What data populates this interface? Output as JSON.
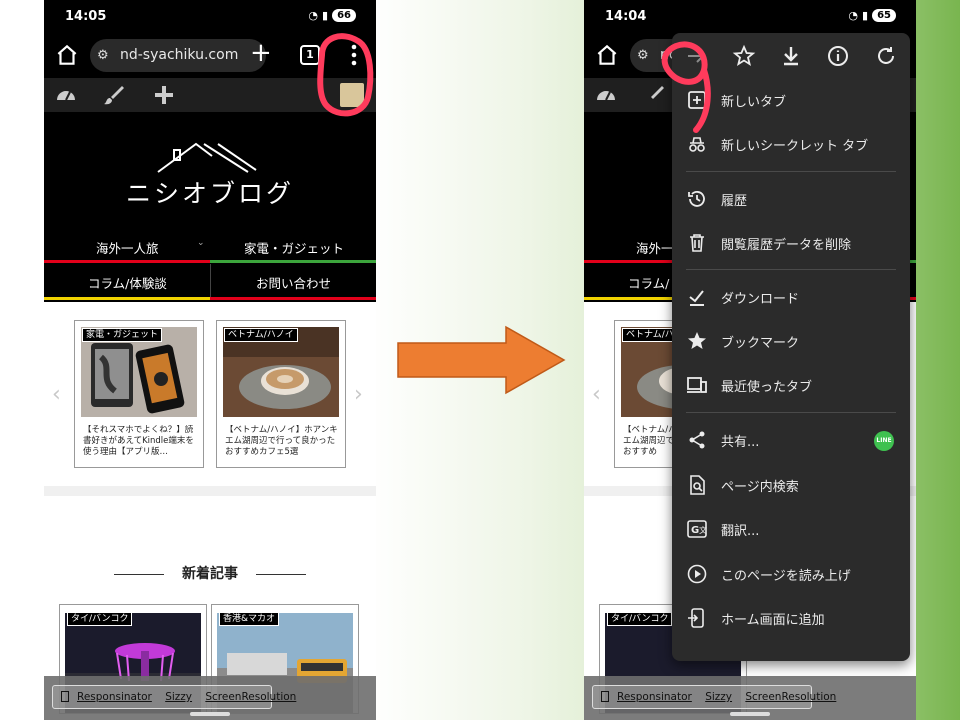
{
  "statusbar_left": {
    "time": "14:05",
    "battery": "66"
  },
  "statusbar_right": {
    "time": "14:04",
    "battery": "65"
  },
  "browser": {
    "url": "nd-syachiku.com",
    "url_partial": "nc",
    "tab_count": "1"
  },
  "site": {
    "logo": "ニシオブログ",
    "nav": [
      "海外一人旅",
      "家電・ガジェット",
      "コラム/体験談",
      "お問い合わせ"
    ],
    "nav_right_partial": [
      "海外一",
      "コラム/"
    ]
  },
  "carousel": [
    {
      "tag": "家電・ガジェット",
      "title": "【それスマホでよくね？】読書好きがあえてKindle端末を使う理由【アプリ版…"
    },
    {
      "tag": "ベトナム/ハノイ",
      "title": "【ベトナム/ハノイ】ホアンキエム湖周辺で行って良かったおすすめカフェ5選"
    }
  ],
  "carousel_right": {
    "tag": "ベトナム/ハ",
    "title": "【ベトナム/ハノイ】ホアンキエム湖周辺で行って良かったおすすめ"
  },
  "section": {
    "new_articles": "新着記事"
  },
  "new_cards": [
    {
      "tag": "タイ/バンコク"
    },
    {
      "tag": "香港&マカオ"
    }
  ],
  "devtools": {
    "links": [
      "Responsinator",
      "Sizzy",
      "ScreenResolution"
    ]
  },
  "menu": {
    "toolbar": [
      "forward-icon",
      "star-icon",
      "download-icon",
      "info-icon",
      "refresh-icon"
    ],
    "items": [
      {
        "label": "新しいタブ",
        "icon": "new-tab-icon"
      },
      {
        "label": "新しいシークレット タブ",
        "icon": "incognito-icon"
      },
      {
        "label": "履歴",
        "icon": "history-icon"
      },
      {
        "label": "閲覧履歴データを削除",
        "icon": "trash-icon"
      },
      {
        "label": "ダウンロード",
        "icon": "downloads-icon"
      },
      {
        "label": "ブックマーク",
        "icon": "bookmark-star-icon"
      },
      {
        "label": "最近使ったタブ",
        "icon": "recent-tabs-icon"
      },
      {
        "label": "共有...",
        "icon": "share-icon"
      },
      {
        "label": "ページ内検索",
        "icon": "find-in-page-icon"
      },
      {
        "label": "翻訳...",
        "icon": "translate-icon"
      },
      {
        "label": "このページを読み上げ",
        "icon": "read-aloud-icon"
      },
      {
        "label": "ホーム画面に追加",
        "icon": "add-to-home-icon"
      }
    ],
    "share_badge": "LINE"
  },
  "colors": {
    "annotation": "#ff3b5c",
    "arrow": "#ed7d31",
    "nav_red": "#e2001a",
    "nav_green": "#3ca53c",
    "nav_yellow": "#f1d300"
  }
}
